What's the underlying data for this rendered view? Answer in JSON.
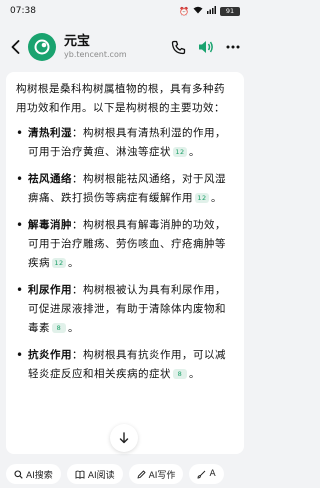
{
  "status": {
    "time": "07:38",
    "battery": "91"
  },
  "header": {
    "title": "元宝",
    "subtitle": "yb.tencent.com"
  },
  "message": {
    "intro": "构树根是桑科构树属植物的根，具有多种药用功效和作用。以下是构树根的主要功效：",
    "items": [
      {
        "term": "清热利湿",
        "text": "：构树根具有清热利湿的作用，可用于治疗黄疸、淋浊等症状",
        "cite": "12",
        "end": "。"
      },
      {
        "term": "祛风通络",
        "text": "：构树根能祛风通络，对于风湿痹痛、跌打损伤等病症有缓解作用",
        "cite": "12",
        "end": "。"
      },
      {
        "term": "解毒消肿",
        "text": "：构树根具有解毒消肿的功效，可用于治疗雕疡、劳伤咳血、疔疮痈肿等疾病",
        "cite": "12",
        "end": "。"
      },
      {
        "term": "利尿作用",
        "text": "：构树根被认为具有利尿作用，可促进尿液排泄，有助于清除体内废物和毒素",
        "cite": "8",
        "end": "。"
      },
      {
        "term": "抗炎作用",
        "text": "：构树根具有抗炎作用，可以减轻炎症反应和相关疾病的症状",
        "cite": "8",
        "end": "。"
      }
    ]
  },
  "tools": [
    {
      "label": "AI搜索",
      "icon": "search-icon"
    },
    {
      "label": "AI阅读",
      "icon": "book-icon"
    },
    {
      "label": "AI写作",
      "icon": "pen-icon"
    },
    {
      "label": "A",
      "icon": "brush-icon"
    }
  ]
}
